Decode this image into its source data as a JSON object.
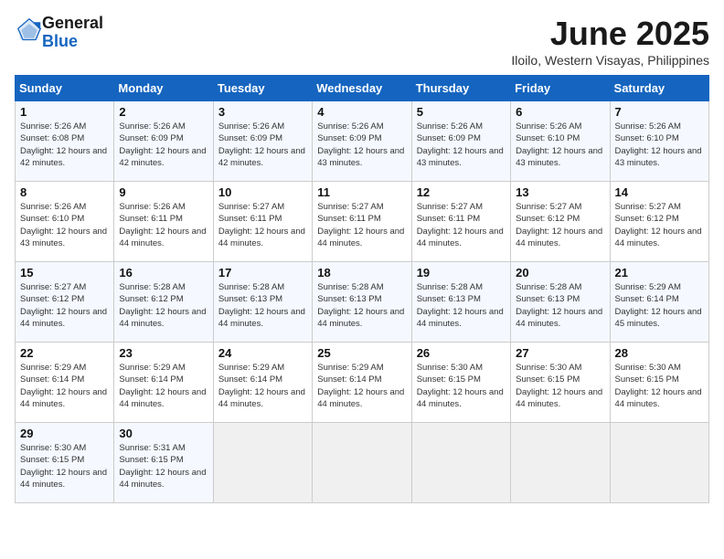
{
  "header": {
    "logo_line1": "General",
    "logo_line2": "Blue",
    "title": "June 2025",
    "subtitle": "Iloilo, Western Visayas, Philippines"
  },
  "days_of_week": [
    "Sunday",
    "Monday",
    "Tuesday",
    "Wednesday",
    "Thursday",
    "Friday",
    "Saturday"
  ],
  "weeks": [
    [
      {
        "day": "1",
        "sunrise": "5:26 AM",
        "sunset": "6:08 PM",
        "daylight": "12 hours and 42 minutes."
      },
      {
        "day": "2",
        "sunrise": "5:26 AM",
        "sunset": "6:09 PM",
        "daylight": "12 hours and 42 minutes."
      },
      {
        "day": "3",
        "sunrise": "5:26 AM",
        "sunset": "6:09 PM",
        "daylight": "12 hours and 42 minutes."
      },
      {
        "day": "4",
        "sunrise": "5:26 AM",
        "sunset": "6:09 PM",
        "daylight": "12 hours and 43 minutes."
      },
      {
        "day": "5",
        "sunrise": "5:26 AM",
        "sunset": "6:09 PM",
        "daylight": "12 hours and 43 minutes."
      },
      {
        "day": "6",
        "sunrise": "5:26 AM",
        "sunset": "6:10 PM",
        "daylight": "12 hours and 43 minutes."
      },
      {
        "day": "7",
        "sunrise": "5:26 AM",
        "sunset": "6:10 PM",
        "daylight": "12 hours and 43 minutes."
      }
    ],
    [
      {
        "day": "8",
        "sunrise": "5:26 AM",
        "sunset": "6:10 PM",
        "daylight": "12 hours and 43 minutes."
      },
      {
        "day": "9",
        "sunrise": "5:26 AM",
        "sunset": "6:11 PM",
        "daylight": "12 hours and 44 minutes."
      },
      {
        "day": "10",
        "sunrise": "5:27 AM",
        "sunset": "6:11 PM",
        "daylight": "12 hours and 44 minutes."
      },
      {
        "day": "11",
        "sunrise": "5:27 AM",
        "sunset": "6:11 PM",
        "daylight": "12 hours and 44 minutes."
      },
      {
        "day": "12",
        "sunrise": "5:27 AM",
        "sunset": "6:11 PM",
        "daylight": "12 hours and 44 minutes."
      },
      {
        "day": "13",
        "sunrise": "5:27 AM",
        "sunset": "6:12 PM",
        "daylight": "12 hours and 44 minutes."
      },
      {
        "day": "14",
        "sunrise": "5:27 AM",
        "sunset": "6:12 PM",
        "daylight": "12 hours and 44 minutes."
      }
    ],
    [
      {
        "day": "15",
        "sunrise": "5:27 AM",
        "sunset": "6:12 PM",
        "daylight": "12 hours and 44 minutes."
      },
      {
        "day": "16",
        "sunrise": "5:28 AM",
        "sunset": "6:12 PM",
        "daylight": "12 hours and 44 minutes."
      },
      {
        "day": "17",
        "sunrise": "5:28 AM",
        "sunset": "6:13 PM",
        "daylight": "12 hours and 44 minutes."
      },
      {
        "day": "18",
        "sunrise": "5:28 AM",
        "sunset": "6:13 PM",
        "daylight": "12 hours and 44 minutes."
      },
      {
        "day": "19",
        "sunrise": "5:28 AM",
        "sunset": "6:13 PM",
        "daylight": "12 hours and 44 minutes."
      },
      {
        "day": "20",
        "sunrise": "5:28 AM",
        "sunset": "6:13 PM",
        "daylight": "12 hours and 44 minutes."
      },
      {
        "day": "21",
        "sunrise": "5:29 AM",
        "sunset": "6:14 PM",
        "daylight": "12 hours and 45 minutes."
      }
    ],
    [
      {
        "day": "22",
        "sunrise": "5:29 AM",
        "sunset": "6:14 PM",
        "daylight": "12 hours and 44 minutes."
      },
      {
        "day": "23",
        "sunrise": "5:29 AM",
        "sunset": "6:14 PM",
        "daylight": "12 hours and 44 minutes."
      },
      {
        "day": "24",
        "sunrise": "5:29 AM",
        "sunset": "6:14 PM",
        "daylight": "12 hours and 44 minutes."
      },
      {
        "day": "25",
        "sunrise": "5:29 AM",
        "sunset": "6:14 PM",
        "daylight": "12 hours and 44 minutes."
      },
      {
        "day": "26",
        "sunrise": "5:30 AM",
        "sunset": "6:15 PM",
        "daylight": "12 hours and 44 minutes."
      },
      {
        "day": "27",
        "sunrise": "5:30 AM",
        "sunset": "6:15 PM",
        "daylight": "12 hours and 44 minutes."
      },
      {
        "day": "28",
        "sunrise": "5:30 AM",
        "sunset": "6:15 PM",
        "daylight": "12 hours and 44 minutes."
      }
    ],
    [
      {
        "day": "29",
        "sunrise": "5:30 AM",
        "sunset": "6:15 PM",
        "daylight": "12 hours and 44 minutes."
      },
      {
        "day": "30",
        "sunrise": "5:31 AM",
        "sunset": "6:15 PM",
        "daylight": "12 hours and 44 minutes."
      },
      null,
      null,
      null,
      null,
      null
    ]
  ],
  "labels": {
    "sunrise_prefix": "Sunrise: ",
    "sunset_prefix": "Sunset: ",
    "daylight_prefix": "Daylight: "
  }
}
